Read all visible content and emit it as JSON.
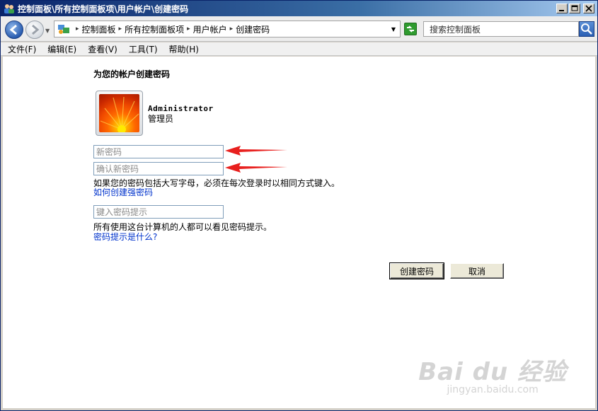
{
  "window": {
    "title": "控制面板\\所有控制面板项\\用户帐户\\创建密码"
  },
  "address": {
    "crumbs": [
      "控制面板",
      "所有控制面板项",
      "用户帐户",
      "创建密码"
    ]
  },
  "search": {
    "placeholder": "搜索控制面板"
  },
  "menu": {
    "items": [
      "文件(F)",
      "编辑(E)",
      "查看(V)",
      "工具(T)",
      "帮助(H)"
    ]
  },
  "page": {
    "heading": "为您的帐户创建密码",
    "user": {
      "name": "Administrator",
      "role": "管理员"
    },
    "new_password_placeholder": "新密码",
    "confirm_password_placeholder": "确认新密码",
    "case_note": "如果您的密码包括大写字母，必须在每次登录时以相同方式键入。",
    "strong_link": "如何创建强密码",
    "hint_placeholder": "键入密码提示",
    "hint_note": "所有使用这台计算机的人都可以看见密码提示。",
    "hint_link": "密码提示是什么?",
    "create_button": "创建密码",
    "cancel_button": "取消"
  },
  "watermark": {
    "logo": "Bai du 经验",
    "url": "jingyan.baidu.com"
  },
  "colors": {
    "titlebar": "#0a246a",
    "link": "#0033cc",
    "annotation_arrow": "#e8201e"
  }
}
